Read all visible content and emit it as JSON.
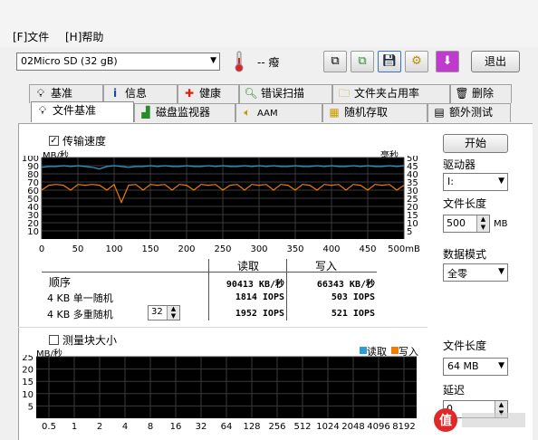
{
  "menu": {
    "file": "[F]文件",
    "help": "[H]帮助"
  },
  "toolbar": {
    "drive": "02Micro SD   (32 gB)",
    "temperature": "-- 癈",
    "exit_label": "退出"
  },
  "tabs_row1": [
    {
      "label": "基准",
      "icon": "lightbulb-icon"
    },
    {
      "label": "信息",
      "icon": "info-icon"
    },
    {
      "label": "健康",
      "icon": "health-cross-icon"
    },
    {
      "label": "错误扫描",
      "icon": "magnifier-icon"
    },
    {
      "label": "文件夹占用率",
      "icon": "folder-icon"
    },
    {
      "label": "删除",
      "icon": "trash-icon"
    }
  ],
  "tabs_row2": [
    {
      "label": "文件基准",
      "icon": "file-benchmark-icon"
    },
    {
      "label": "磁盘监视器",
      "icon": "monitor-chart-icon"
    },
    {
      "label": "AAM",
      "icon": "speaker-icon"
    },
    {
      "label": "随机存取",
      "icon": "random-access-icon"
    },
    {
      "label": "额外测试",
      "icon": "extra-tests-icon"
    }
  ],
  "transfer": {
    "checkbox_label": "传输速度",
    "left_unit": "MB/秒",
    "right_unit": "毫秒"
  },
  "chart_data": [
    {
      "type": "line",
      "title": "",
      "xlabel": "",
      "ylabel": "MB/秒",
      "y2label": "毫秒",
      "x_tick_labels": [
        "0",
        "50",
        "100",
        "150",
        "200",
        "250",
        "300",
        "350",
        "400",
        "450",
        "500mB"
      ],
      "y_tick_labels": [
        "100",
        "90",
        "80",
        "70",
        "60",
        "50",
        "40",
        "30",
        "20",
        "10"
      ],
      "y2_tick_labels": [
        "50",
        "45",
        "40",
        "35",
        "30",
        "25",
        "20",
        "15",
        "10",
        "5"
      ],
      "xlim": [
        0,
        500
      ],
      "ylim": [
        0,
        100
      ],
      "y2lim": [
        0,
        50
      ],
      "grid": true,
      "series": [
        {
          "color": "#2a9fd6",
          "x": [
            0,
            10,
            20,
            30,
            40,
            50,
            60,
            70,
            80,
            90,
            100,
            110,
            120,
            130,
            140,
            150,
            160,
            170,
            180,
            190,
            200,
            210,
            220,
            230,
            240,
            250,
            260,
            270,
            280,
            290,
            300,
            310,
            320,
            330,
            340,
            350,
            360,
            370,
            380,
            390,
            400,
            410,
            420,
            430,
            440,
            450,
            460,
            470,
            480,
            490,
            500
          ],
          "y": [
            88,
            89,
            89,
            90,
            89,
            90,
            89,
            88,
            86,
            89,
            90,
            89,
            88,
            89,
            89,
            90,
            89,
            90,
            89,
            89,
            90,
            89,
            89,
            90,
            89,
            90,
            89,
            89,
            90,
            89,
            90,
            89,
            90,
            89,
            89,
            90,
            89,
            89,
            90,
            89,
            90,
            89,
            89,
            90,
            89,
            90,
            89,
            89,
            90,
            89,
            90
          ]
        },
        {
          "color": "#f07c00",
          "x": [
            0,
            10,
            20,
            30,
            40,
            50,
            60,
            70,
            80,
            90,
            100,
            110,
            120,
            130,
            140,
            150,
            160,
            170,
            180,
            190,
            200,
            210,
            220,
            230,
            240,
            250,
            260,
            270,
            280,
            290,
            300,
            310,
            320,
            330,
            340,
            350,
            360,
            370,
            380,
            390,
            400,
            410,
            420,
            430,
            440,
            450,
            460,
            470,
            480,
            490,
            500
          ],
          "y": [
            60,
            66,
            67,
            66,
            60,
            67,
            66,
            67,
            66,
            60,
            67,
            45,
            66,
            67,
            60,
            67,
            66,
            67,
            60,
            67,
            66,
            60,
            67,
            66,
            67,
            60,
            66,
            67,
            60,
            67,
            66,
            67,
            60,
            67,
            66,
            60,
            67,
            66,
            60,
            67,
            66,
            67,
            60,
            67,
            66,
            60,
            67,
            66,
            67,
            60,
            66
          ]
        }
      ]
    },
    {
      "type": "bar",
      "title": "",
      "ylabel": "MB/秒",
      "categories": [
        "0.5",
        "1",
        "2",
        "4",
        "8",
        "16",
        "32",
        "64",
        "128",
        "256",
        "512",
        "1024",
        "2048",
        "4096",
        "8192"
      ],
      "y_tick_labels": [
        "25",
        "20",
        "15",
        "10",
        "5"
      ],
      "ylim": [
        0,
        25
      ],
      "grid": true,
      "legend": [
        "读取",
        "写入"
      ],
      "legend_colors": [
        "#2a9fd6",
        "#f07c00"
      ],
      "legend_position": "top-right",
      "series": []
    }
  ],
  "results": {
    "header_read": "读取",
    "header_write": "写入",
    "rows": [
      {
        "label": "顺序",
        "read": "90413 KB/秒",
        "write": "66343 KB/秒"
      },
      {
        "label": "4 KB 单一随机",
        "read": "1814 IOPS",
        "write": "503 IOPS"
      },
      {
        "label": "4 KB 多重随机",
        "read": "1952 IOPS",
        "write": "521 IOPS"
      }
    ],
    "queue_depth": "32"
  },
  "right_panel": {
    "start_label": "开始",
    "drive_label": "驱动器",
    "drive_value": "I:",
    "file_length_label": "文件长度",
    "file_length_value": "500",
    "file_length_unit": "MB",
    "data_mode_label": "数据模式",
    "data_mode_value": "全零"
  },
  "block": {
    "checkbox_label": "测量块大小",
    "file_length_label": "文件长度",
    "file_length_value": "64 MB",
    "delay_label": "延迟",
    "delay_value": "0"
  }
}
